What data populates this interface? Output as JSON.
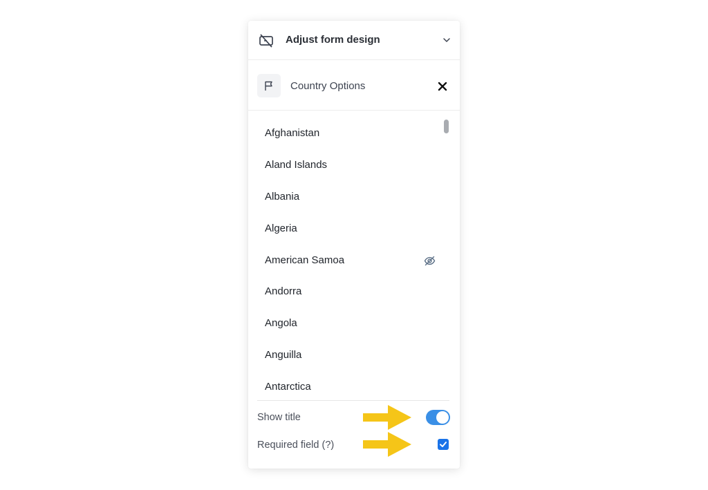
{
  "header": {
    "title": "Adjust form design",
    "icon": "form-design-icon",
    "chevron_icon": "chevron-down-icon"
  },
  "subheader": {
    "title": "Country Options",
    "icon": "flag-icon",
    "close_icon": "close-icon"
  },
  "countries": [
    {
      "label": "Afghanistan",
      "hidden": false
    },
    {
      "label": "Aland Islands",
      "hidden": false
    },
    {
      "label": "Albania",
      "hidden": false
    },
    {
      "label": "Algeria",
      "hidden": false
    },
    {
      "label": "American Samoa",
      "hidden": true,
      "icon": "eye-off-icon"
    },
    {
      "label": "Andorra",
      "hidden": false
    },
    {
      "label": "Angola",
      "hidden": false
    },
    {
      "label": "Anguilla",
      "hidden": false
    },
    {
      "label": "Antarctica",
      "hidden": false
    }
  ],
  "settings": {
    "show_title": {
      "label": "Show title",
      "enabled": true
    },
    "required_field": {
      "label": "Required field (?)",
      "checked": true
    }
  },
  "colors": {
    "accent": "#3a8fe6",
    "checkbox": "#1a73e8",
    "annotation_arrow": "#f5c518",
    "text": "#1f232a"
  }
}
